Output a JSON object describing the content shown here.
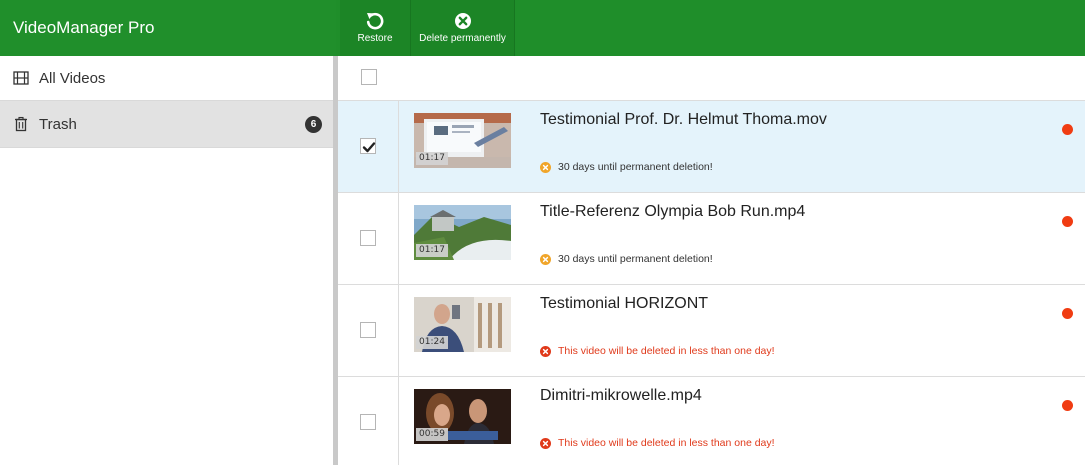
{
  "app": {
    "title": "VideoManager Pro"
  },
  "toolbar": {
    "restore_label": "Restore",
    "delete_label": "Delete permanently"
  },
  "sidebar": {
    "items": [
      {
        "label": "All Videos",
        "icon": "film-icon"
      },
      {
        "label": "Trash",
        "icon": "trash-icon",
        "badge": "6"
      }
    ]
  },
  "videos": [
    {
      "title": "Testimonial Prof. Dr. Helmut Thoma.mov",
      "duration": "01:17",
      "selected": true,
      "notice": "30 days until permanent deletion!",
      "notice_type": "warning"
    },
    {
      "title": "Title-Referenz Olympia Bob Run.mp4",
      "duration": "01:17",
      "selected": false,
      "notice": "30 days until permanent deletion!",
      "notice_type": "warning"
    },
    {
      "title": "Testimonial HORIZONT",
      "duration": "01:24",
      "selected": false,
      "notice": "This video will be deleted in less than one day!",
      "notice_type": "danger"
    },
    {
      "title": "Dimitri-mikrowelle.mp4",
      "duration": "00:59",
      "selected": false,
      "notice": "This video will be deleted in less than one day!",
      "notice_type": "danger"
    }
  ],
  "colors": {
    "header_green": "#1f8e2a",
    "selected_row": "#e4f3fb",
    "warning": "#f0a52a",
    "danger": "#e03a1b",
    "status_dot": "#f03c12"
  }
}
